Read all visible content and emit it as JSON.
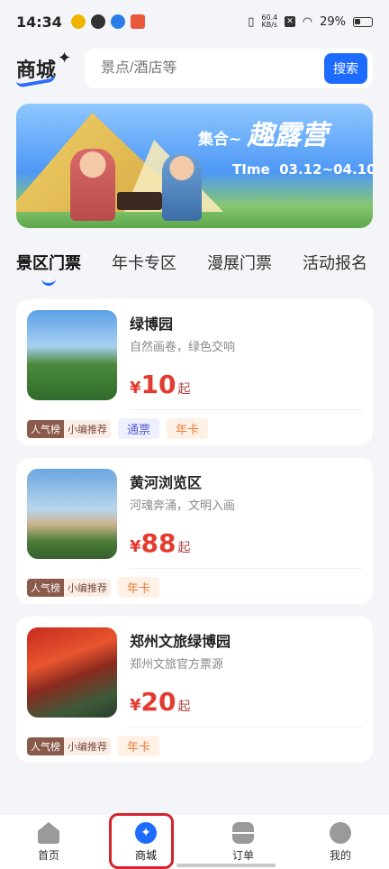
{
  "status_bar": {
    "time": "14:34",
    "net_speed_value": "60.4",
    "net_speed_unit": "KB/s",
    "battery": "29%"
  },
  "header": {
    "logo": "商城",
    "search_placeholder": "景点/酒店等",
    "search_button": "搜索"
  },
  "banner": {
    "title_small": "集合~",
    "title_big": "趣露营",
    "time_label": "TIme",
    "time_range": "03.12~04.10"
  },
  "tabs": [
    {
      "label": "景区门票",
      "active": true
    },
    {
      "label": "年卡专区",
      "active": false
    },
    {
      "label": "漫展门票",
      "active": false
    },
    {
      "label": "活动报名",
      "active": false
    }
  ],
  "cards": [
    {
      "name": "绿博园",
      "desc": "自然画卷，绿色交响",
      "currency": "¥",
      "price": "10",
      "price_suffix": "起",
      "rank_a": "人气榜",
      "rank_b": "小编推荐",
      "tags": [
        "通票",
        "年卡"
      ]
    },
    {
      "name": "黄河浏览区",
      "desc": "河魂奔涌，文明入画",
      "currency": "¥",
      "price": "88",
      "price_suffix": "起",
      "rank_a": "人气榜",
      "rank_b": "小编推荐",
      "tags": [
        "年卡"
      ]
    },
    {
      "name": "郑州文旅绿博园",
      "desc": "郑州文旅官方票源",
      "currency": "¥",
      "price": "20",
      "price_suffix": "起",
      "rank_a": "人气榜",
      "rank_b": "小编推荐",
      "tags": [
        "年卡"
      ]
    }
  ],
  "bottom_nav": [
    {
      "label": "首页",
      "icon": "home-icon"
    },
    {
      "label": "商城",
      "icon": "mall-sparkle-icon",
      "active": true
    },
    {
      "label": "订单",
      "icon": "order-icon"
    },
    {
      "label": "我的",
      "icon": "profile-icon"
    }
  ],
  "colors": {
    "accent": "#1e6bff",
    "price": "#e43a2f",
    "highlight": "#d4232d"
  }
}
